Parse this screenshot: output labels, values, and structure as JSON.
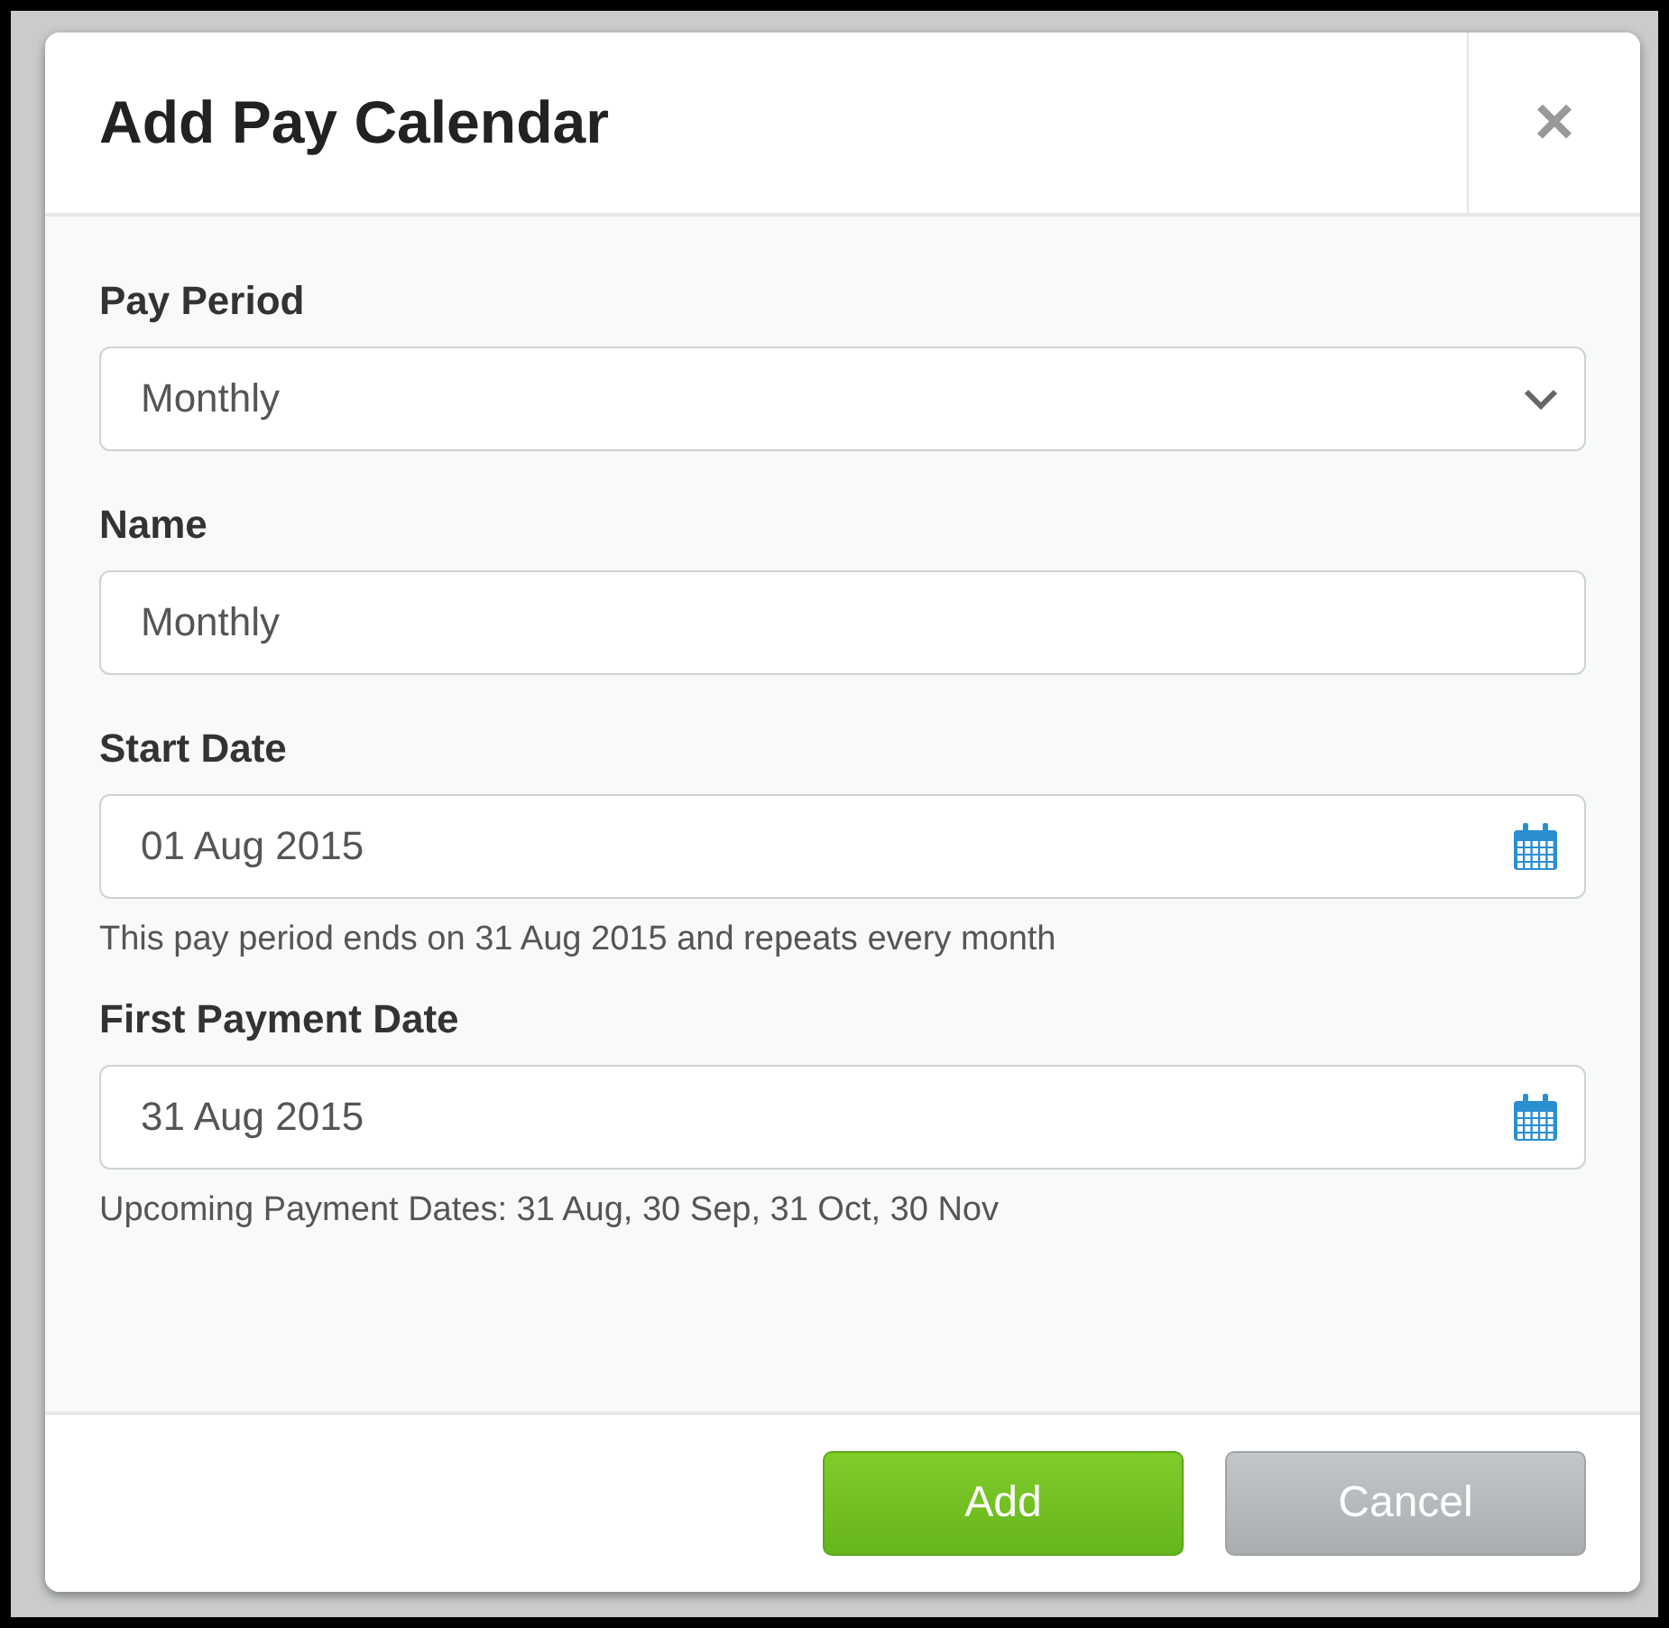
{
  "dialog": {
    "title": "Add Pay Calendar",
    "close": "×"
  },
  "fields": [
    {
      "kind": "select",
      "label": "Pay Period",
      "value": "Monthly"
    },
    {
      "kind": "text",
      "label": "Name",
      "value": "Monthly"
    },
    {
      "kind": "date",
      "label": "Start Date",
      "value": "01 Aug 2015",
      "help": "This pay period ends on 31 Aug 2015 and repeats every month"
    },
    {
      "kind": "date",
      "label": "First Payment Date",
      "value": "31 Aug 2015",
      "help": "Upcoming Payment Dates: 31 Aug, 30 Sep, 31 Oct, 30 Nov"
    }
  ],
  "buttons": [
    {
      "kind": "primary",
      "label": "Add"
    },
    {
      "kind": "secondary",
      "label": "Cancel"
    }
  ]
}
